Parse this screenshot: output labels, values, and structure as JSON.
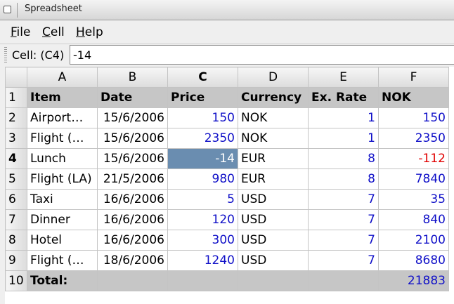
{
  "window": {
    "title": "Spreadsheet"
  },
  "menu": [
    {
      "label": "File",
      "underline": "F",
      "rest": "ile"
    },
    {
      "label": "Cell",
      "underline": "C",
      "rest": "ell"
    },
    {
      "label": "Help",
      "underline": "H",
      "rest": "elp"
    }
  ],
  "cellbar": {
    "label": "Cell: (C4)",
    "value": "-14"
  },
  "grid": {
    "columns": [
      "A",
      "B",
      "C",
      "D",
      "E",
      "F"
    ],
    "active_column": "C",
    "active_row": "4",
    "header_row": {
      "row": "1",
      "cells": [
        "Item",
        "Date",
        "Price",
        "Currency",
        "Ex. Rate",
        "NOK"
      ]
    },
    "rows": [
      {
        "row": "2",
        "item": "Airport…",
        "date": "15/6/2006",
        "price": "150",
        "currency": "NOK",
        "rate": "1",
        "nok": "150"
      },
      {
        "row": "3",
        "item": "Flight (…",
        "date": "15/6/2006",
        "price": "2350",
        "currency": "NOK",
        "rate": "1",
        "nok": "2350"
      },
      {
        "row": "4",
        "item": "Lunch",
        "date": "15/6/2006",
        "price": "-14",
        "currency": "EUR",
        "rate": "8",
        "nok": "-112"
      },
      {
        "row": "5",
        "item": "Flight (LA)",
        "date": "21/5/2006",
        "price": "980",
        "currency": "EUR",
        "rate": "8",
        "nok": "7840"
      },
      {
        "row": "6",
        "item": "Taxi",
        "date": "16/6/2006",
        "price": "5",
        "currency": "USD",
        "rate": "7",
        "nok": "35"
      },
      {
        "row": "7",
        "item": "Dinner",
        "date": "16/6/2006",
        "price": "120",
        "currency": "USD",
        "rate": "7",
        "nok": "840"
      },
      {
        "row": "8",
        "item": "Hotel",
        "date": "16/6/2006",
        "price": "300",
        "currency": "USD",
        "rate": "7",
        "nok": "2100"
      },
      {
        "row": "9",
        "item": "Flight (…",
        "date": "18/6/2006",
        "price": "1240",
        "currency": "USD",
        "rate": "7",
        "nok": "8680"
      }
    ],
    "total_row": {
      "row": "10",
      "label": "Total:",
      "nok": "21883"
    }
  },
  "colors": {
    "number": "#1010c8",
    "negative": "#e00000",
    "selection": "#6a8db0",
    "header_bg": "#c6c6c6"
  }
}
